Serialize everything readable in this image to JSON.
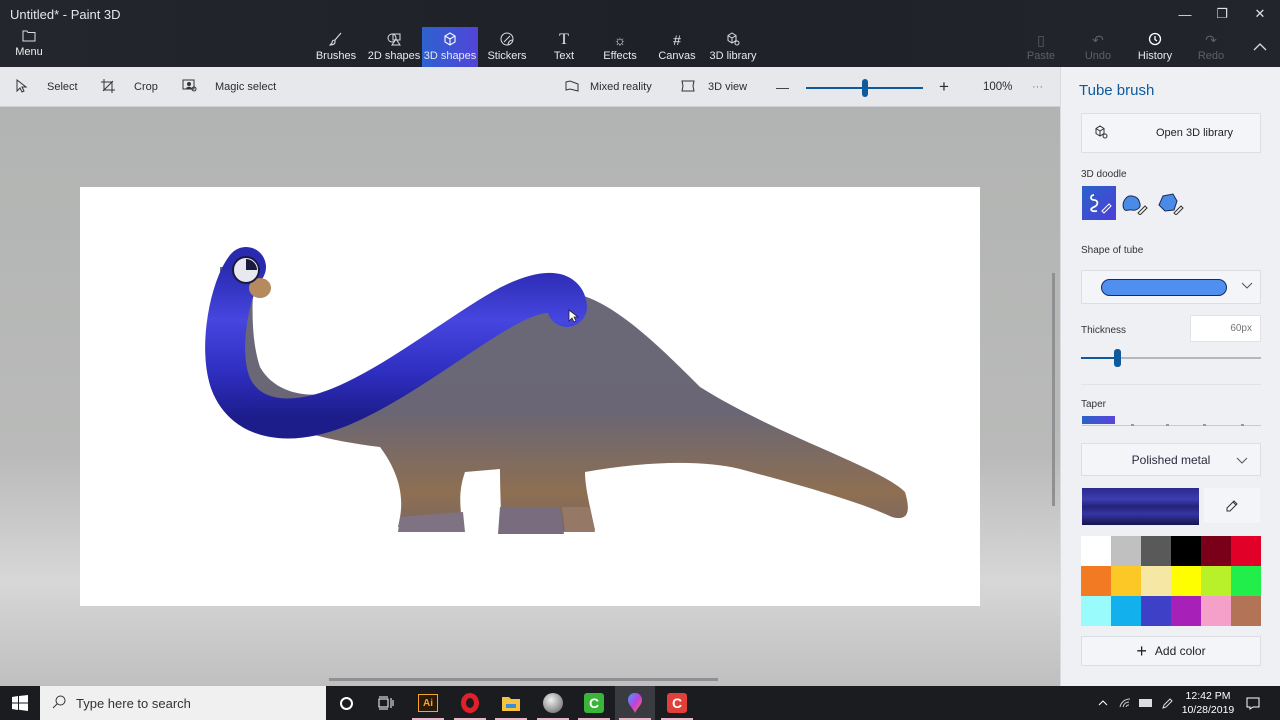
{
  "window": {
    "title": "Untitled* - Paint 3D",
    "controls": {
      "minimize": "—",
      "maximize": "❐",
      "close": "✕"
    }
  },
  "ribbon": {
    "menu_label": "Menu",
    "tabs": [
      {
        "label": "Brushes",
        "icon": "brush-icon",
        "active": false
      },
      {
        "label": "2D shapes",
        "icon": "2d-shapes-icon",
        "active": false
      },
      {
        "label": "3D shapes",
        "icon": "3d-shapes-icon",
        "active": true
      },
      {
        "label": "Stickers",
        "icon": "stickers-icon",
        "active": false
      },
      {
        "label": "Text",
        "icon": "text-icon",
        "active": false
      },
      {
        "label": "Effects",
        "icon": "effects-icon",
        "active": false
      },
      {
        "label": "Canvas",
        "icon": "canvas-icon",
        "active": false
      },
      {
        "label": "3D library",
        "icon": "3d-library-icon",
        "active": false
      }
    ],
    "right_actions": [
      {
        "label": "Paste",
        "icon": "paste-icon",
        "enabled": false
      },
      {
        "label": "Undo",
        "icon": "undo-icon",
        "enabled": false
      },
      {
        "label": "History",
        "icon": "history-icon",
        "enabled": true
      },
      {
        "label": "Redo",
        "icon": "redo-icon",
        "enabled": false
      }
    ]
  },
  "toolbar": {
    "select_label": "Select",
    "crop_label": "Crop",
    "magic_select_label": "Magic select",
    "mixed_reality_label": "Mixed reality",
    "view_3d_label": "3D view",
    "zoom_out": "—",
    "zoom_in": "+",
    "zoom_level": "100%",
    "zoom_fraction": 0.5,
    "more": "···"
  },
  "canvas": {
    "content": "Brontosaurus photo with a blue 3D tube doodle traced along its neck",
    "tube_color": "#3333c8"
  },
  "panel": {
    "title": "Tube brush",
    "open_library_label": "Open 3D library",
    "doodle_label": "3D doodle",
    "doodle_options": [
      "tube-doodle",
      "soft-doodle",
      "sharp-doodle"
    ],
    "shape_label": "Shape of tube",
    "shape_value": "rounded",
    "thickness_label": "Thickness",
    "thickness_value": "60px",
    "thickness_fraction": 0.2,
    "taper_label": "Taper",
    "taper_selected_index": 0,
    "material": "Polished metal",
    "current_color": "#2a2a8e",
    "palette": [
      "#ffffff",
      "#c0c0c0",
      "#595959",
      "#000000",
      "#7a0019",
      "#e10027",
      "#f27a22",
      "#fbc825",
      "#f7e7a5",
      "#fefe00",
      "#b8f02a",
      "#21ee4a",
      "#99fbfb",
      "#12b0ec",
      "#3f40c8",
      "#a720b7",
      "#f5a0c8",
      "#b27356"
    ],
    "add_color_label": "Add color",
    "accent": "#0e5a9c"
  },
  "taskbar": {
    "search_placeholder": "Type here to search",
    "apps": [
      "cortana",
      "task-view",
      "illustrator",
      "opera",
      "file-explorer",
      "browser",
      "camtasia",
      "paint-3d",
      "camtasia-recorder"
    ],
    "time": "12:42 PM",
    "date": "10/28/2019"
  }
}
